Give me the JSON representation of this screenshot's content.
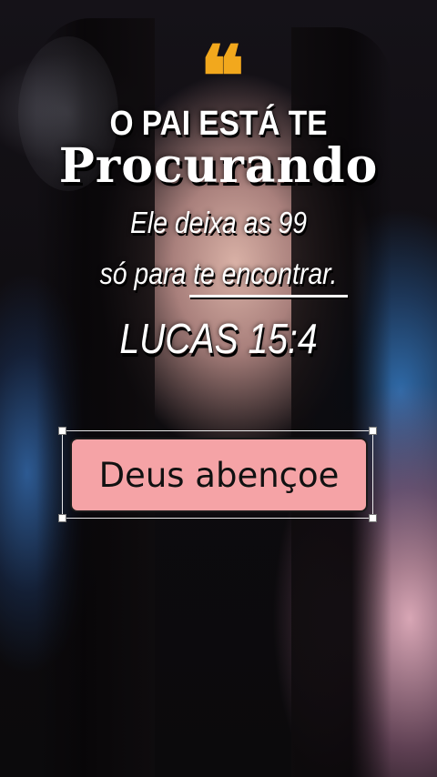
{
  "colors": {
    "quote_icon": "#f2a81d",
    "heading_text": "#ffffff",
    "sticker_background": "#f5a3a6",
    "sticker_text": "#111111"
  },
  "quote": {
    "icon": "left-double-quote-icon",
    "glyph": "❝"
  },
  "heading": {
    "line1": "O PAI ESTÁ TE",
    "line2": "Procurando"
  },
  "verse": {
    "line1": "Ele deixa as 99",
    "line2": "só para te encontrar.",
    "reference": "LUCAS 15:4"
  },
  "sticker": {
    "label": "Deus abençoe"
  }
}
